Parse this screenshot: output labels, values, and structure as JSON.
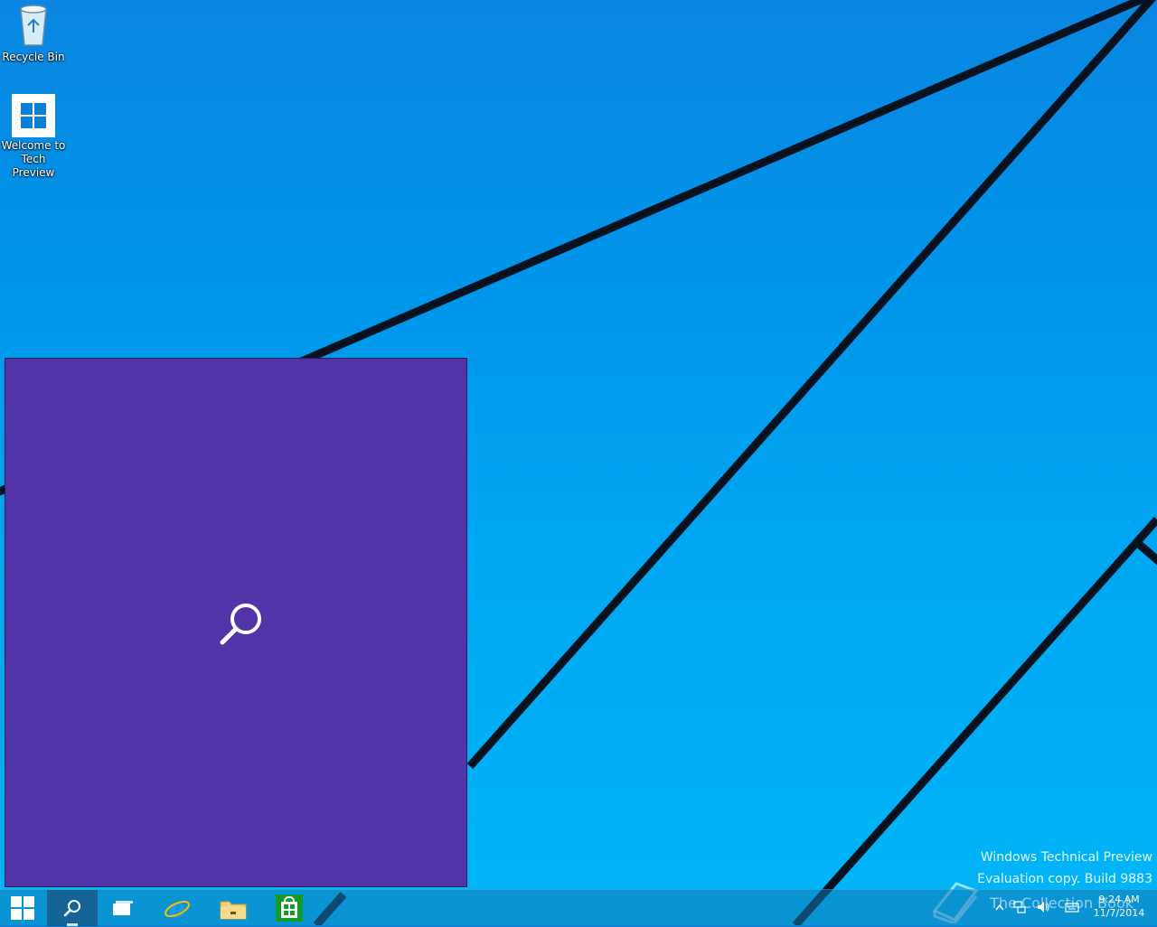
{
  "desktop": {
    "icons": [
      {
        "label": "Recycle Bin",
        "icon": "recycle-bin-icon"
      },
      {
        "label": "Welcome to Tech Preview",
        "icon": "windows-logo-icon"
      }
    ]
  },
  "search_panel": {
    "icon": "search-icon",
    "color": "#5034a8"
  },
  "taskbar": {
    "buttons": [
      {
        "name": "start",
        "icon": "windows-logo-icon"
      },
      {
        "name": "search",
        "icon": "search-icon",
        "active": true
      },
      {
        "name": "task-view",
        "icon": "task-view-icon"
      },
      {
        "name": "internet-explorer",
        "icon": "internet-explorer-icon"
      },
      {
        "name": "file-explorer",
        "icon": "folder-icon"
      },
      {
        "name": "store",
        "icon": "store-icon"
      }
    ],
    "tray": {
      "icons": [
        "chevron-up-icon",
        "network-icon",
        "volume-icon",
        "keyboard-icon"
      ],
      "time": "9:24 AM",
      "date": "11/7/2014"
    }
  },
  "watermark": {
    "line1": "Windows Technical Preview",
    "line2": "Evaluation copy. Build 9883",
    "line3": "The Collection Book"
  },
  "colors": {
    "accent": "#5034a8",
    "desktop": "#00a7f2",
    "taskbar": "#1478b4"
  }
}
